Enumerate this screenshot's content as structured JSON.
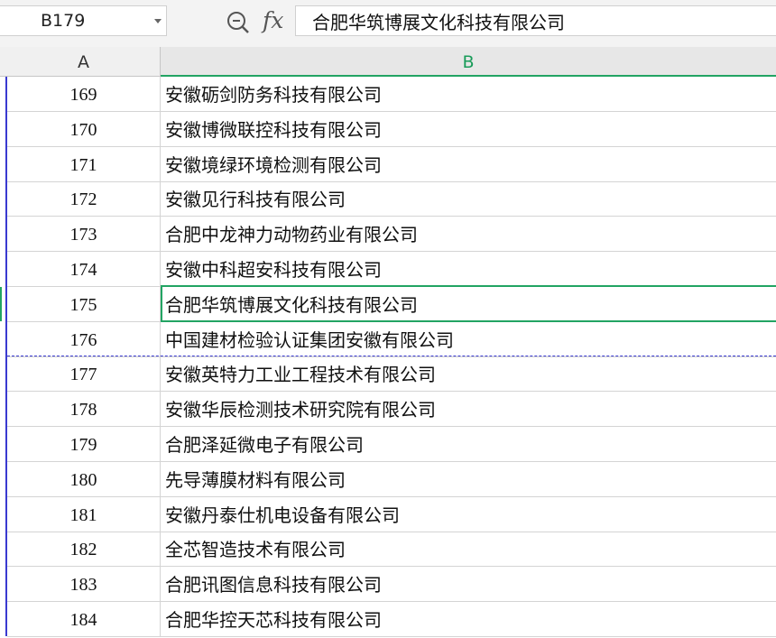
{
  "name_box": {
    "value": "B179"
  },
  "formula_bar": {
    "fx_label": "fx",
    "content": "合肥华筑博展文化科技有限公司"
  },
  "columns": [
    {
      "label": "A"
    },
    {
      "label": "B"
    }
  ],
  "rows": [
    {
      "num": "169",
      "name": "安徽砺剑防务科技有限公司"
    },
    {
      "num": "170",
      "name": "安徽博微联控科技有限公司"
    },
    {
      "num": "171",
      "name": "安徽境绿环境检测有限公司"
    },
    {
      "num": "172",
      "name": "安徽见行科技有限公司"
    },
    {
      "num": "173",
      "name": "合肥中龙神力动物药业有限公司"
    },
    {
      "num": "174",
      "name": "安徽中科超安科技有限公司"
    },
    {
      "num": "175",
      "name": "合肥华筑博展文化科技有限公司"
    },
    {
      "num": "176",
      "name": "中国建材检验认证集团安徽有限公司"
    },
    {
      "num": "177",
      "name": "安徽英特力工业工程技术有限公司"
    },
    {
      "num": "178",
      "name": "安徽华辰检测技术研究院有限公司"
    },
    {
      "num": "179",
      "name": "合肥泽延微电子有限公司"
    },
    {
      "num": "180",
      "name": "先导薄膜材料有限公司"
    },
    {
      "num": "181",
      "name": "安徽丹泰仕机电设备有限公司"
    },
    {
      "num": "182",
      "name": "全芯智造技术有限公司"
    },
    {
      "num": "183",
      "name": "合肥讯图信息科技有限公司"
    },
    {
      "num": "184",
      "name": "合肥华控天芯科技有限公司"
    }
  ],
  "selected_row_index": 6,
  "colors": {
    "accent": "#22a463",
    "page_break": "#3a3ad0"
  },
  "icons": {
    "zoom": "zoom-search-icon",
    "dropdown": "chevron-down-icon"
  }
}
